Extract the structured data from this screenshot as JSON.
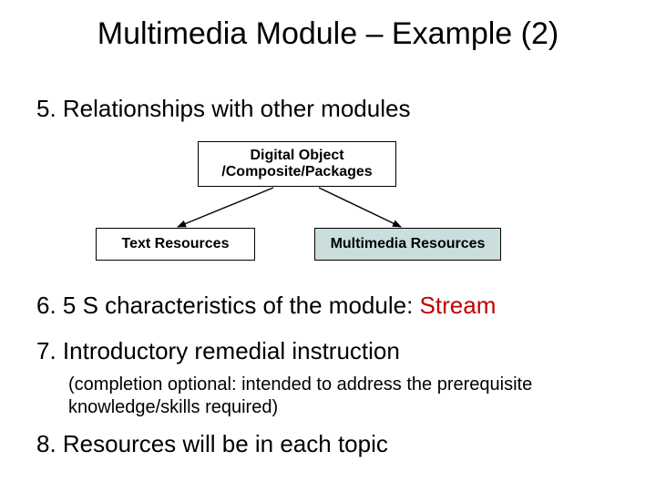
{
  "title": "Multimedia Module – Example (2)",
  "item5": "5. Relationships with other modules",
  "diagram": {
    "top_box_line1": "Digital Object",
    "top_box_line2": "/Composite/Packages",
    "left_box": "Text Resources",
    "right_box": "Multimedia Resources"
  },
  "item6_prefix": "6. 5 S characteristics of the module: ",
  "item6_highlight": "Stream",
  "item7": "7. Introductory remedial instruction",
  "item7_sub": "(completion optional: intended to address the prerequisite knowledge/skills required)",
  "item8": "8. Resources will be in each topic"
}
